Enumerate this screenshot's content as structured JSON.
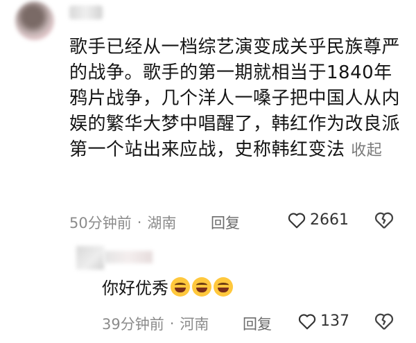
{
  "comment1": {
    "text": "歌手已经从一档综艺演变成关乎民族尊严的战争。歌手的第一期就相当于1840年鸦片战争，几个洋人一嗓子把中国人从内娱的繁华大梦中唱醒了，韩红作为改良派第一个站出来应战，史称韩红变法",
    "collapse_label": "收起",
    "time": "50分钟前",
    "separator": "·",
    "location": "湖南",
    "reply_label": "回复",
    "like_count": "2661"
  },
  "comment2": {
    "text": "你好优秀",
    "emojis": [
      "laughing-crying-icon",
      "laughing-crying-icon",
      "laughing-crying-icon"
    ],
    "time": "39分钟前",
    "separator": "·",
    "location": "河南",
    "reply_label": "回复",
    "like_count": "137"
  }
}
